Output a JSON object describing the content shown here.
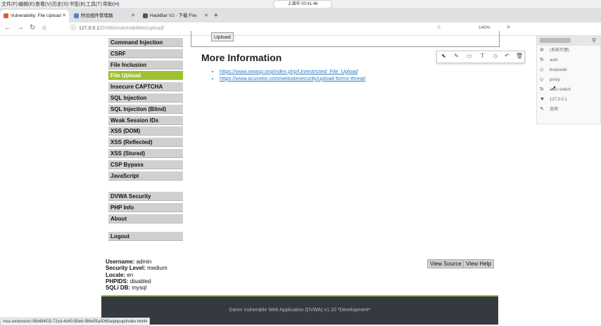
{
  "menubar": {
    "items": [
      "文件(F)",
      "编辑(E)",
      "查看(V)",
      "历史(S)",
      "书签(B)",
      "工具(T)",
      "帮助(H)"
    ],
    "time": "上演中 00:41:46"
  },
  "tabs": [
    {
      "title": "Vulnerability: File Upload",
      "color": "#e05a3a"
    },
    {
      "title": "附加组件管理器",
      "color": "#5b7cc7"
    },
    {
      "title": "HackBar V2 - 下载 Fire",
      "color": "#555555"
    }
  ],
  "address": {
    "host": "127.0.0.1",
    "path": "/DVWA/vulnerabilities/upload/"
  },
  "zoom": "140%",
  "popup": {
    "items": [
      {
        "icon": "⊘",
        "label": "(系统代理)"
      },
      {
        "icon": "↻",
        "label": "auto"
      },
      {
        "icon": "◇",
        "label": "burpsuite"
      },
      {
        "icon": "◇",
        "label": "proxy"
      },
      {
        "icon": "↻",
        "label": "auto switch"
      },
      {
        "icon": "▼",
        "label": "127.0.0.1"
      },
      {
        "icon": "✎",
        "label": "选项"
      }
    ]
  },
  "menu": {
    "group1": [
      "Command Injection",
      "CSRF",
      "File Inclusion",
      "File Upload",
      "Insecure CAPTCHA",
      "SQL Injection",
      "SQL Injection (Blind)",
      "Weak Session IDs",
      "XSS (DOM)",
      "XSS (Reflected)",
      "XSS (Stored)",
      "CSP Bypass",
      "JavaScript"
    ],
    "group2": [
      "DVWA Security",
      "PHP Info",
      "About"
    ],
    "logout": "Logout"
  },
  "upload_button": "Upload",
  "more_info": {
    "title": "More Information",
    "links": [
      "https://www.owasp.org/index.php/Unrestricted_File_Upload",
      "https://www.acunetix.com/websitesecurity/upload-forms-threat/"
    ]
  },
  "userinfo": {
    "username_label": "Username:",
    "username": "admin",
    "security_label": "Security Level:",
    "security": "medium",
    "locale_label": "Locale:",
    "locale": "en",
    "phpids_label": "PHPIDS:",
    "phpids": "disabled",
    "sqlidb_label": "SQLi DB:",
    "sqlidb": "mysql"
  },
  "buttons": {
    "view_source": "View Source",
    "view_help": "View Help"
  },
  "footer": "Damn Vulnerable Web Application (DVWA) v1.10 *Development*",
  "status_url": "moz-extension://8b484f15-72cd-4c60-95eb-f86e05a3065a/popup/index.html#"
}
